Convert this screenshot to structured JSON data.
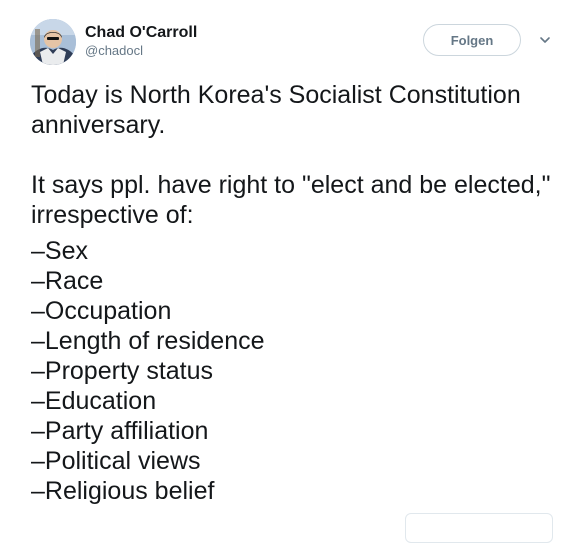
{
  "user": {
    "name": "Chad O'Carroll",
    "handle": "@chadocl"
  },
  "header": {
    "follow_label": "Folgen"
  },
  "tweet": {
    "line1": "Today is North Korea's Socialist Constitution anniversary.",
    "line2": "It says ppl. have right to \"elect and be elected,\" irrespective of:",
    "items": [
      "–Sex",
      "–Race",
      "–Occupation",
      "–Length of residence",
      "–Property status",
      "–Education",
      "–Party affiliation",
      "–Political views",
      "–Religious belief"
    ]
  },
  "colors": {
    "text": "#14171a",
    "muted": "#657786",
    "border": "#ccd6dd"
  },
  "icons": {
    "menu": "chevron-down-icon"
  }
}
